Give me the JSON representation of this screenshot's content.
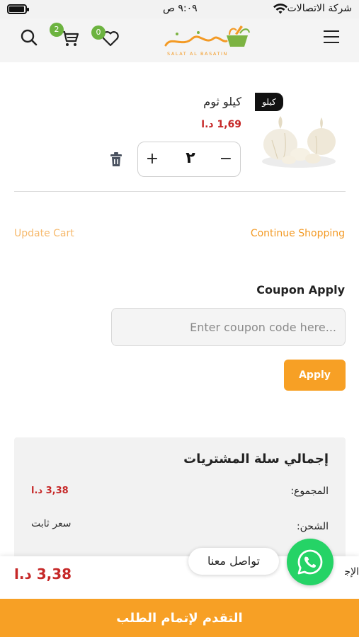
{
  "status_bar": {
    "carrier": "شركة الاتصالات",
    "time": "٩:٠٩ ص"
  },
  "header": {
    "cart_count": "2",
    "wishlist_count": "0",
    "logo_arabic": "سلة البساتين",
    "logo_latin": "SALAT AL BASATIN",
    "icons": [
      "search-icon",
      "cart-icon",
      "heart-icon",
      "menu-icon"
    ]
  },
  "cart_item": {
    "unit_badge": "كيلو",
    "name": "كيلو ثوم",
    "price": "1,69 د.ا",
    "quantity": "٢",
    "plus_label": "+",
    "minus_label": "−"
  },
  "actions": {
    "update_cart": "Update Cart",
    "continue_shopping": "Continue Shopping"
  },
  "coupon": {
    "title": "Coupon Apply",
    "placeholder": "Enter coupon code here...",
    "apply_label": "Apply"
  },
  "totals": {
    "title": "إجمالي سلة المشتريات",
    "subtotal_label": "المجموع:",
    "subtotal_value": "3,38 د.ا",
    "shipping_label": "الشحن:",
    "shipping_value": "سعر ثابت",
    "total_label": "الإجمالي:",
    "total_value": "3,38 د.ا"
  },
  "checkout": {
    "label": "التقدم لإتمام الطلب"
  },
  "whatsapp": {
    "label": "تواصل معنا"
  },
  "colors": {
    "accent": "#f7a025",
    "price": "#c62828",
    "badge": "#6cb33f",
    "whatsapp": "#25d366"
  }
}
